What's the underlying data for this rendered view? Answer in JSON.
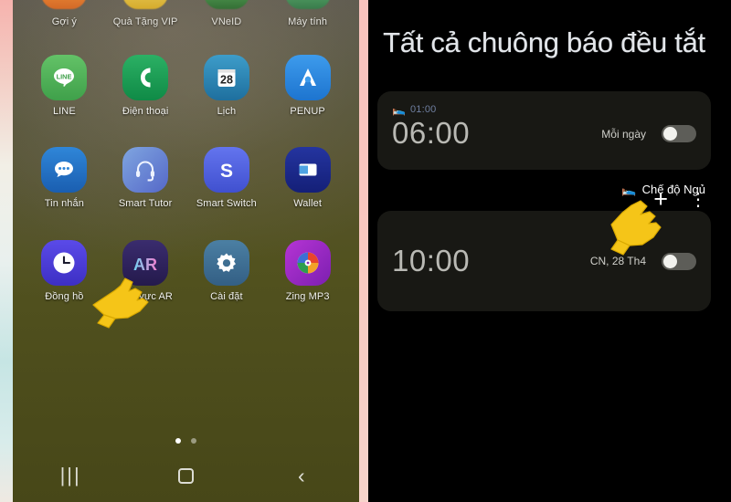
{
  "left_panel": {
    "name": "android-home-screen",
    "rows": [
      {
        "partial": true,
        "apps": [
          {
            "label": "Gợi ý",
            "icon": "suggestions-icon",
            "color": "#e07a2a"
          },
          {
            "label": "Quà Tặng VIP",
            "icon": "vip-gift-icon",
            "color": "#e9c33c"
          },
          {
            "label": "VNeID",
            "icon": "vneid-icon",
            "color": "#2f7a34"
          },
          {
            "label": "Máy tính",
            "icon": "calculator-icon",
            "color": "#3a8f52"
          }
        ]
      },
      {
        "partial": false,
        "apps": [
          {
            "label": "LINE",
            "icon": "line-icon",
            "color": "#4cae50"
          },
          {
            "label": "Điện thoại",
            "icon": "phone-icon",
            "color": "#1f9d55"
          },
          {
            "label": "Lịch",
            "icon": "calendar-icon",
            "color": "#2a86b8",
            "badge": "28"
          },
          {
            "label": "PENUP",
            "icon": "penup-icon",
            "color": "#2a8ae0"
          }
        ]
      },
      {
        "partial": false,
        "apps": [
          {
            "label": "Tin nhắn",
            "icon": "messages-icon",
            "color": "#2271c4"
          },
          {
            "label": "Smart Tutor",
            "icon": "headset-icon",
            "color": "#5f7fd0"
          },
          {
            "label": "Smart Switch",
            "icon": "smart-switch-icon",
            "color": "#4f63e0"
          },
          {
            "label": "Wallet",
            "icon": "wallet-icon",
            "color": "#1b2f9c"
          }
        ]
      },
      {
        "partial": false,
        "apps": [
          {
            "label": "Đồng hồ",
            "icon": "clock-icon",
            "color": "#4a3fd6"
          },
          {
            "label": "Khu vực AR",
            "icon": "ar-zone-icon",
            "color": "#2d2359",
            "text": "AR"
          },
          {
            "label": "Cài đặt",
            "icon": "gear-icon",
            "color": "#3f6f92"
          },
          {
            "label": "Zing MP3",
            "icon": "zing-mp3-icon",
            "color": "#9c2fc4"
          }
        ]
      }
    ],
    "page_dots": {
      "count": 2,
      "active_index": 0
    },
    "navbar": {
      "recents_label": "|||",
      "home_label": "home-square",
      "back_label": "‹"
    },
    "cursor": "pointing-hand-cursor"
  },
  "right_panel": {
    "name": "samsung-clock-alarm-screen",
    "title": "Tất cả chuông báo đều tắt",
    "toolbar": {
      "add_label": "+",
      "more_label": "⋮"
    },
    "alarms": [
      {
        "bed_icon": "bed-icon",
        "bed_time": "01:00",
        "time": "06:00",
        "repeat": "Mỗi ngày",
        "enabled": false
      },
      {
        "time": "10:00",
        "repeat": "CN, 28 Th4",
        "enabled": false
      }
    ],
    "sleep_mode": {
      "icon": "bed-icon",
      "label": "Chế độ Ngủ"
    },
    "cursor": "pointing-hand-cursor"
  },
  "colors": {
    "accent_blue": "#4a90d9",
    "card_bg": "#181814",
    "panel_bg": "#000000",
    "cursor_yellow": "#f5c518",
    "frame_pink": "#f6b3ae",
    "frame_cyan": "#c6e5e4"
  }
}
